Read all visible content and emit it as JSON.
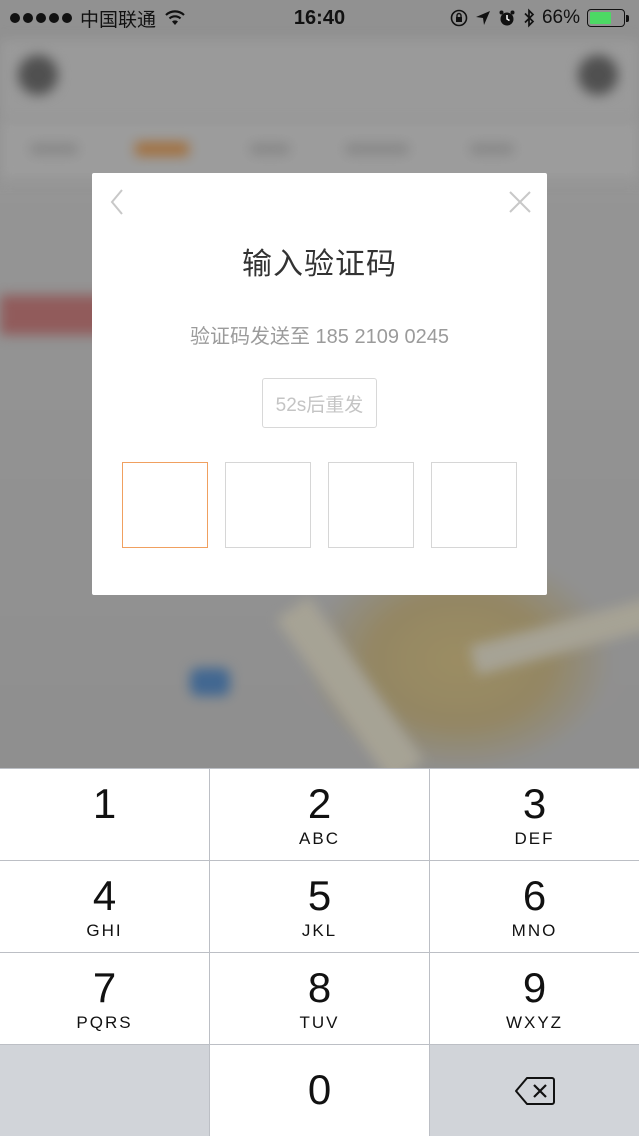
{
  "status_bar": {
    "carrier": "中国联通",
    "time": "16:40",
    "battery_percent": "66%",
    "battery_level": 0.66,
    "icons": [
      "signal-dots-icon",
      "wifi-icon",
      "orientation-lock-icon",
      "location-arrow-icon",
      "alarm-icon",
      "bluetooth-icon",
      "battery-icon"
    ]
  },
  "dialog": {
    "title": "输入验证码",
    "subtitle": "验证码发送至 185 2109 0245",
    "resend_label": "52s后重发",
    "back_icon": "back-chevron-icon",
    "close_icon": "close-icon",
    "code_length": 4,
    "active_box_index": 0,
    "active_color": "#f0a060"
  },
  "keypad": {
    "keys": [
      {
        "digit": "1",
        "letters": ""
      },
      {
        "digit": "2",
        "letters": "ABC"
      },
      {
        "digit": "3",
        "letters": "DEF"
      },
      {
        "digit": "4",
        "letters": "GHI"
      },
      {
        "digit": "5",
        "letters": "JKL"
      },
      {
        "digit": "6",
        "letters": "MNO"
      },
      {
        "digit": "7",
        "letters": "PQRS"
      },
      {
        "digit": "8",
        "letters": "TUV"
      },
      {
        "digit": "9",
        "letters": "WXYZ"
      },
      {
        "digit": "0",
        "letters": ""
      }
    ],
    "delete_icon": "backspace-icon"
  }
}
